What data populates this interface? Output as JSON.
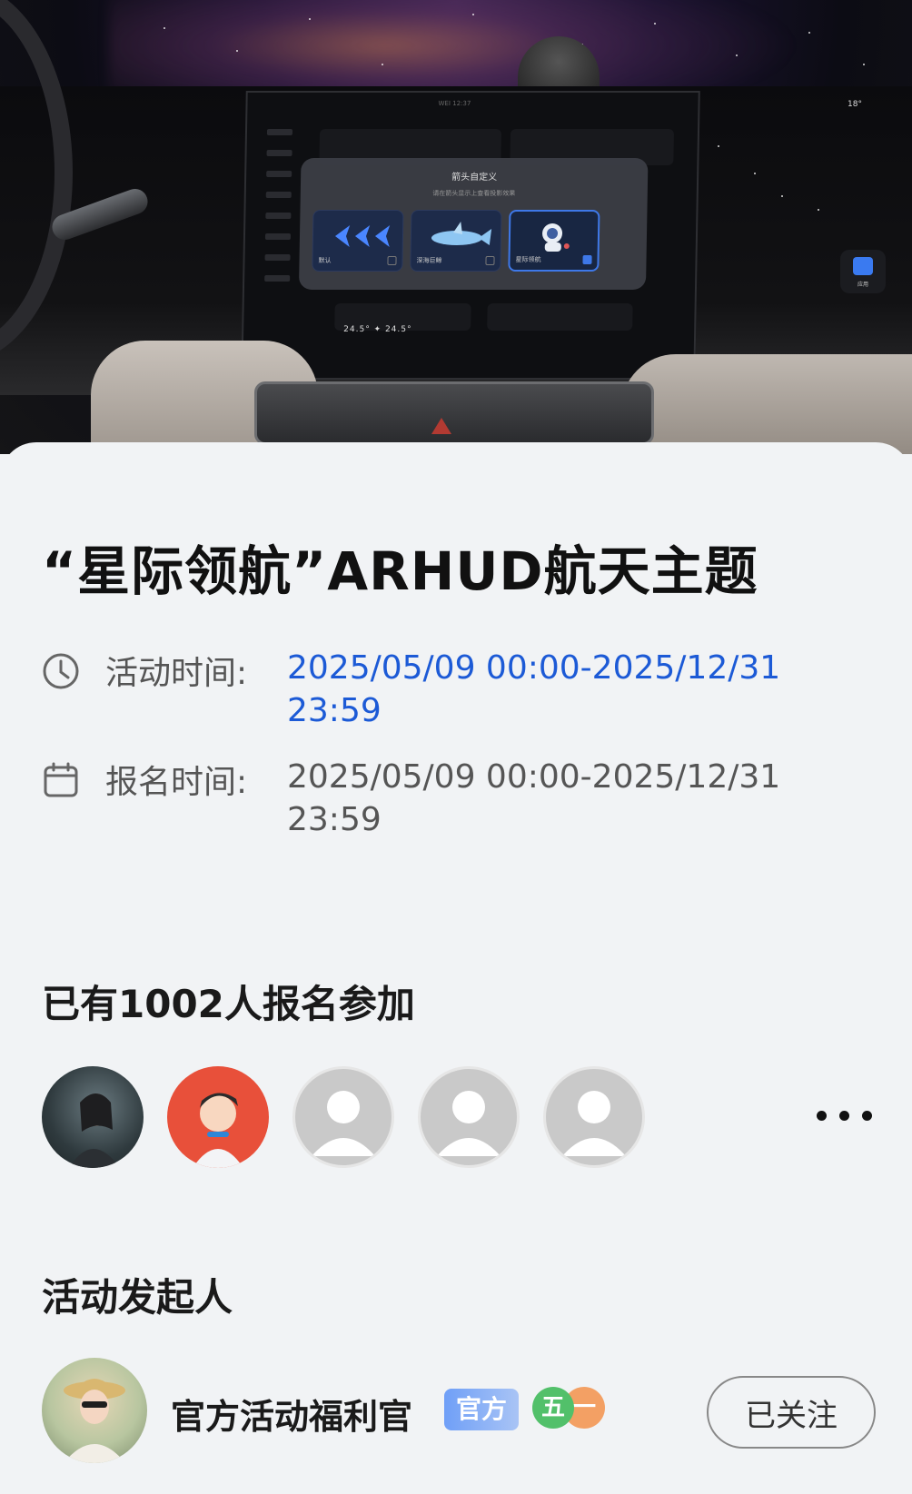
{
  "hero": {
    "screen_status": "WEI 12:37",
    "popup_title": "箭头自定义",
    "popup_subtitle": "请在箭头显示上查看投影效果",
    "options": [
      {
        "label": "默认",
        "selected": false
      },
      {
        "label": "深海巨鲸",
        "selected": false
      },
      {
        "label": "星际领航",
        "selected": true
      }
    ],
    "climate": "24.5°  ✦  24.5°",
    "weather": "18°",
    "app_label": "应用"
  },
  "activity": {
    "title": "“星际领航”ARHUD航天主题",
    "activity_time_label": "活动时间:",
    "activity_time_value": "2025/05/09 00:00-2025/12/31 23:59",
    "signup_time_label": "报名时间:",
    "signup_time_value": "2025/05/09 00:00-2025/12/31 23:59",
    "participants_title": "已有1002人报名参加",
    "organizer_title": "活动发起人"
  },
  "organizer": {
    "name": "官方活动福利官",
    "badge_official": "官方",
    "level_left": "五",
    "level_right": "一",
    "follow_label": "已关注"
  },
  "colors": {
    "accent_blue": "#1c5ad6",
    "background": "#f1f3f5",
    "level_green": "#52c06a",
    "level_orange": "#f3a064"
  },
  "icons": [
    "clock-icon",
    "calendar-icon",
    "more-dots-icon",
    "default-avatar-icon"
  ]
}
